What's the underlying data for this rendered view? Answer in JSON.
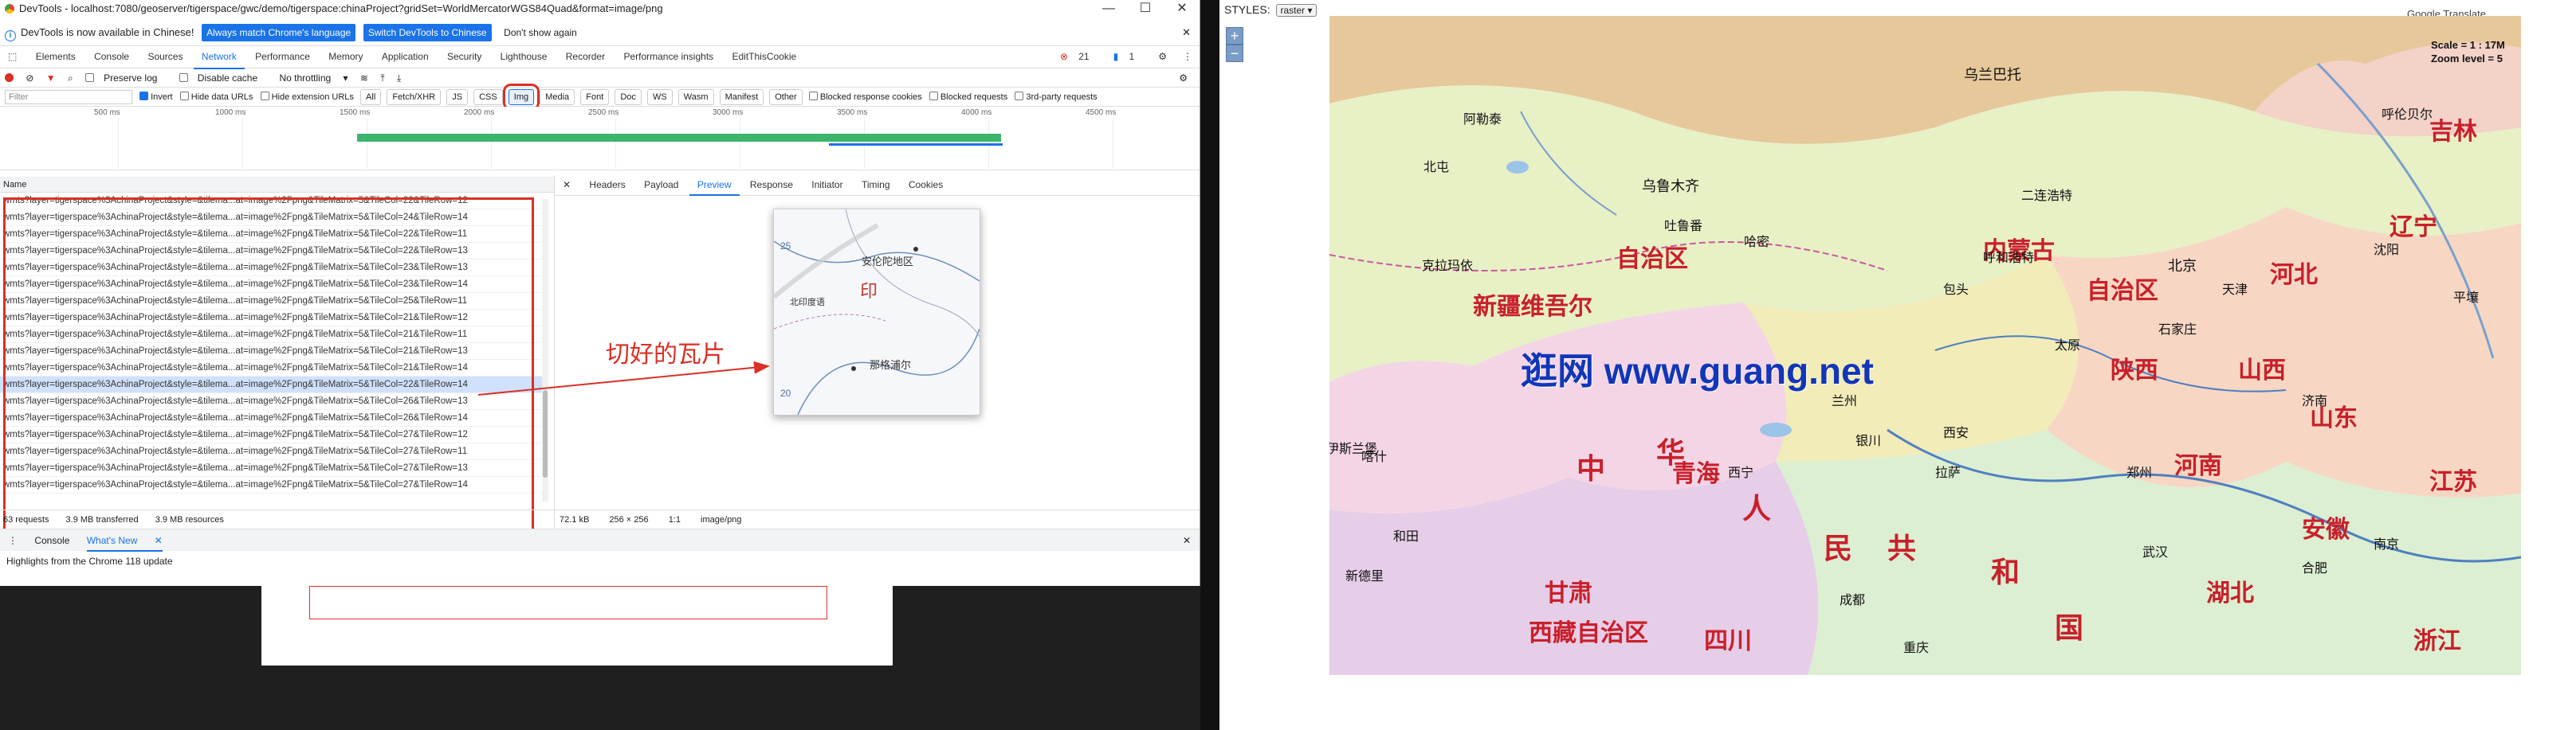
{
  "devtools": {
    "title": "DevTools - localhost:7080/geoserver/tigerspace/gwc/demo/tigerspace:chinaProject?gridSet=WorldMercatorWGS84Quad&format=image/png",
    "infobar": {
      "text": "DevTools is now available in Chinese!",
      "match_button": "Always match Chrome's language",
      "switch_button": "Switch DevTools to Chinese",
      "dismiss": "Don't show again"
    },
    "tabs": [
      "Elements",
      "Console",
      "Sources",
      "Network",
      "Performance",
      "Memory",
      "Application",
      "Security",
      "Lighthouse",
      "Recorder",
      "Performance insights",
      "EditThisCookie"
    ],
    "active_tab": "Network",
    "badges": {
      "errors": "21",
      "messages": "1"
    },
    "toolbar": {
      "preserve_log": "Preserve log",
      "disable_cache": "Disable cache",
      "throttling": "No throttling"
    },
    "filter": {
      "placeholder": "Filter",
      "invert": "Invert",
      "hide_data_urls": "Hide data URLs",
      "hide_extension_urls": "Hide extension URLs",
      "types": [
        "All",
        "Fetch/XHR",
        "JS",
        "CSS",
        "Img",
        "Media",
        "Font",
        "Doc",
        "WS",
        "Wasm",
        "Manifest",
        "Other"
      ],
      "selected_type": "Img",
      "blocked_cookies": "Blocked response cookies",
      "blocked_requests": "Blocked requests",
      "third_party": "3rd-party requests"
    },
    "timeline_ticks": [
      "500 ms",
      "1000 ms",
      "1500 ms",
      "2000 ms",
      "2500 ms",
      "3000 ms",
      "3500 ms",
      "4000 ms",
      "4500 ms"
    ],
    "list_header": "Name",
    "rows": [
      "wmts?layer=tigerspace%3AchinaProject&style=&tilema...at=image%2Fpng&TileMatrix=5&TileCol=22&TileRow=12",
      "wmts?layer=tigerspace%3AchinaProject&style=&tilema...at=image%2Fpng&TileMatrix=5&TileCol=24&TileRow=14",
      "wmts?layer=tigerspace%3AchinaProject&style=&tilema...at=image%2Fpng&TileMatrix=5&TileCol=22&TileRow=11",
      "wmts?layer=tigerspace%3AchinaProject&style=&tilema...at=image%2Fpng&TileMatrix=5&TileCol=22&TileRow=13",
      "wmts?layer=tigerspace%3AchinaProject&style=&tilema...at=image%2Fpng&TileMatrix=5&TileCol=23&TileRow=13",
      "wmts?layer=tigerspace%3AchinaProject&style=&tilema...at=image%2Fpng&TileMatrix=5&TileCol=23&TileRow=14",
      "wmts?layer=tigerspace%3AchinaProject&style=&tilema...at=image%2Fpng&TileMatrix=5&TileCol=25&TileRow=11",
      "wmts?layer=tigerspace%3AchinaProject&style=&tilema...at=image%2Fpng&TileMatrix=5&TileCol=21&TileRow=12",
      "wmts?layer=tigerspace%3AchinaProject&style=&tilema...at=image%2Fpng&TileMatrix=5&TileCol=21&TileRow=11",
      "wmts?layer=tigerspace%3AchinaProject&style=&tilema...at=image%2Fpng&TileMatrix=5&TileCol=21&TileRow=13",
      "wmts?layer=tigerspace%3AchinaProject&style=&tilema...at=image%2Fpng&TileMatrix=5&TileCol=21&TileRow=14",
      "wmts?layer=tigerspace%3AchinaProject&style=&tilema...at=image%2Fpng&TileMatrix=5&TileCol=22&TileRow=14",
      "wmts?layer=tigerspace%3AchinaProject&style=&tilema...at=image%2Fpng&TileMatrix=5&TileCol=26&TileRow=13",
      "wmts?layer=tigerspace%3AchinaProject&style=&tilema...at=image%2Fpng&TileMatrix=5&TileCol=26&TileRow=14",
      "wmts?layer=tigerspace%3AchinaProject&style=&tilema...at=image%2Fpng&TileMatrix=5&TileCol=27&TileRow=12",
      "wmts?layer=tigerspace%3AchinaProject&style=&tilema...at=image%2Fpng&TileMatrix=5&TileCol=27&TileRow=11",
      "wmts?layer=tigerspace%3AchinaProject&style=&tilema...at=image%2Fpng&TileMatrix=5&TileCol=27&TileRow=13",
      "wmts?layer=tigerspace%3AchinaProject&style=&tilema...at=image%2Fpng&TileMatrix=5&TileCol=27&TileRow=14"
    ],
    "selected_row_index": 11,
    "status": {
      "requests": "63 requests",
      "transferred": "3.9 MB transferred",
      "resources": "3.9 MB resources"
    },
    "preview_tabs": [
      "Headers",
      "Payload",
      "Preview",
      "Response",
      "Initiator",
      "Timing",
      "Cookies"
    ],
    "active_preview_tab": "Preview",
    "preview_info": {
      "size": "72.1 kB",
      "dims": "256 × 256",
      "ratio": "1:1",
      "mime": "image/png"
    },
    "tile_labels": {
      "a": "印",
      "b": "安伦陀地区",
      "c": "北印度语",
      "d": "那格浦尔",
      "e": "25",
      "f": "20"
    },
    "annotation": "切好的瓦片",
    "drawer_tabs": [
      "Console",
      "What's New"
    ],
    "active_drawer_tab": "What's New",
    "drawer_text": "Highlights from the Chrome 118 update"
  },
  "mappage": {
    "styles_label": "STYLES:",
    "style_value": "raster",
    "zoom_in": "+",
    "zoom_out": "−",
    "translate": "Google Translate",
    "scale_text": "Scale = 1 : 17M",
    "zoom_level": "Zoom level = 5",
    "watermark": "逛网 www.guang.net",
    "labels": [
      {
        "t": "乌兰巴托",
        "c": "mlabel",
        "s": 18
      },
      {
        "t": "北屯",
        "c": "mlabel",
        "s": 16
      },
      {
        "t": "阿勒泰",
        "c": "mlabel",
        "s": 16
      },
      {
        "t": "克拉玛依",
        "c": "mlabel",
        "s": 16
      },
      {
        "t": "乌鲁木齐",
        "c": "mlabel",
        "s": 18
      },
      {
        "t": "吐鲁番",
        "c": "mlabel",
        "s": 16
      },
      {
        "t": "哈密",
        "c": "mlabel",
        "s": 16
      },
      {
        "t": "新疆维吾尔",
        "c": "mbig",
        "s": 30
      },
      {
        "t": "自治区",
        "c": "mbig",
        "s": 30
      },
      {
        "t": "内蒙古",
        "c": "mbig",
        "s": 30
      },
      {
        "t": "自治区",
        "c": "mbig",
        "s": 30
      },
      {
        "t": "呼和浩特",
        "c": "mlabel",
        "s": 16
      },
      {
        "t": "二连浩特",
        "c": "mlabel",
        "s": 16
      },
      {
        "t": "包头",
        "c": "mlabel",
        "s": 16
      },
      {
        "t": "银川",
        "c": "mlabel",
        "s": 16
      },
      {
        "t": "西宁",
        "c": "mlabel",
        "s": 16
      },
      {
        "t": "兰州",
        "c": "mlabel",
        "s": 16
      },
      {
        "t": "青海",
        "c": "mbig",
        "s": 30
      },
      {
        "t": "甘肃",
        "c": "mbig",
        "s": 30
      },
      {
        "t": "西藏自治区",
        "c": "mbig",
        "s": 30
      },
      {
        "t": "拉萨",
        "c": "mlabel",
        "s": 16
      },
      {
        "t": "陕西",
        "c": "mbig",
        "s": 30
      },
      {
        "t": "山西",
        "c": "mbig",
        "s": 30
      },
      {
        "t": "河北",
        "c": "mbig",
        "s": 30
      },
      {
        "t": "河南",
        "c": "mbig",
        "s": 30
      },
      {
        "t": "湖北",
        "c": "mbig",
        "s": 30
      },
      {
        "t": "四川",
        "c": "mbig",
        "s": 30
      },
      {
        "t": "重庆",
        "c": "mlabel",
        "s": 16
      },
      {
        "t": "成都",
        "c": "mlabel",
        "s": 16
      },
      {
        "t": "西安",
        "c": "mlabel",
        "s": 16
      },
      {
        "t": "太原",
        "c": "mlabel",
        "s": 16
      },
      {
        "t": "石家庄",
        "c": "mlabel",
        "s": 16
      },
      {
        "t": "郑州",
        "c": "mlabel",
        "s": 16
      },
      {
        "t": "武汉",
        "c": "mlabel",
        "s": 16
      },
      {
        "t": "北京",
        "c": "mlabel",
        "s": 18
      },
      {
        "t": "天津",
        "c": "mlabel",
        "s": 16
      },
      {
        "t": "沈阳",
        "c": "mlabel",
        "s": 16
      },
      {
        "t": "山东",
        "c": "mbig",
        "s": 30
      },
      {
        "t": "济南",
        "c": "mlabel",
        "s": 16
      },
      {
        "t": "辽宁",
        "c": "mbig",
        "s": 30
      },
      {
        "t": "吉林",
        "c": "mbig",
        "s": 30
      },
      {
        "t": "江苏",
        "c": "mbig",
        "s": 30
      },
      {
        "t": "安徽",
        "c": "mbig",
        "s": 30
      },
      {
        "t": "浙江",
        "c": "mbig",
        "s": 30
      },
      {
        "t": "南京",
        "c": "mlabel",
        "s": 16
      },
      {
        "t": "合肥",
        "c": "mlabel",
        "s": 16
      },
      {
        "t": "新德里",
        "c": "mlabel",
        "s": 16
      },
      {
        "t": "喀什",
        "c": "mlabel",
        "s": 16
      },
      {
        "t": "和田",
        "c": "mlabel",
        "s": 16
      },
      {
        "t": "伊斯兰堡",
        "c": "mlabel",
        "s": 16
      },
      {
        "t": "中",
        "c": "mbig",
        "s": 36
      },
      {
        "t": "华",
        "c": "mbig",
        "s": 36
      },
      {
        "t": "人",
        "c": "mbig",
        "s": 36
      },
      {
        "t": "民",
        "c": "mbig",
        "s": 36
      },
      {
        "t": "共",
        "c": "mbig",
        "s": 36
      },
      {
        "t": "和",
        "c": "mbig",
        "s": 36
      },
      {
        "t": "国",
        "c": "mbig",
        "s": 36
      },
      {
        "t": "平壤",
        "c": "mlabel",
        "s": 16
      },
      {
        "t": "呼伦贝尔",
        "c": "mlabel",
        "s": 16
      }
    ]
  }
}
